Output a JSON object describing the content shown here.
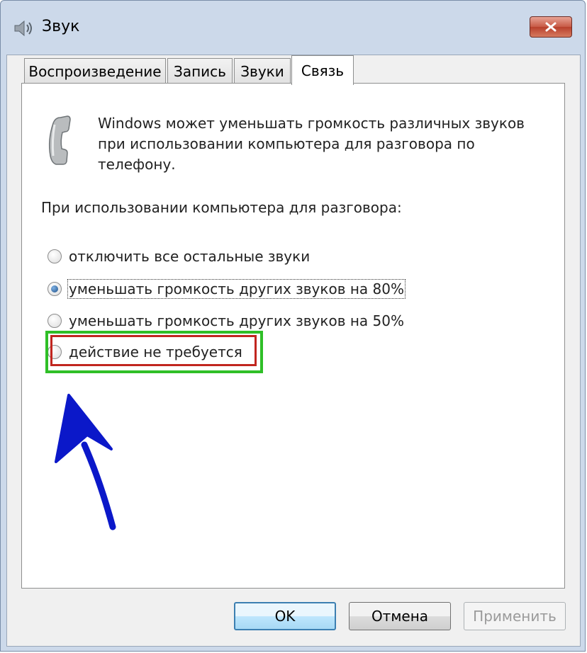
{
  "window": {
    "title": "Звук"
  },
  "tabs": [
    {
      "label": "Воспроизведение"
    },
    {
      "label": "Запись"
    },
    {
      "label": "Звуки"
    },
    {
      "label": "Связь",
      "active": true
    }
  ],
  "panel": {
    "description_lines": [
      "Windows может уменьшать громкость различных звуков",
      "при использовании компьютера для разговора по",
      "телефону."
    ],
    "group_label": "При использовании компьютера для разговора:",
    "options": [
      {
        "label": "отключить все остальные звуки",
        "checked": false
      },
      {
        "label": "уменьшать громкость других звуков на 80%",
        "checked": true
      },
      {
        "label": "уменьшать громкость других звуков на 50%",
        "checked": false
      },
      {
        "label": "действие не требуется",
        "checked": false
      }
    ]
  },
  "buttons": {
    "ok": "OK",
    "cancel": "Отмена",
    "apply": "Применить"
  },
  "annotation_colors": {
    "green_box": "#2fbf27",
    "red_box": "#c1261f",
    "arrow": "#0b18c9"
  },
  "icons": {
    "window": "speaker-icon",
    "close": "close-icon",
    "phone": "phone-handset-icon"
  }
}
